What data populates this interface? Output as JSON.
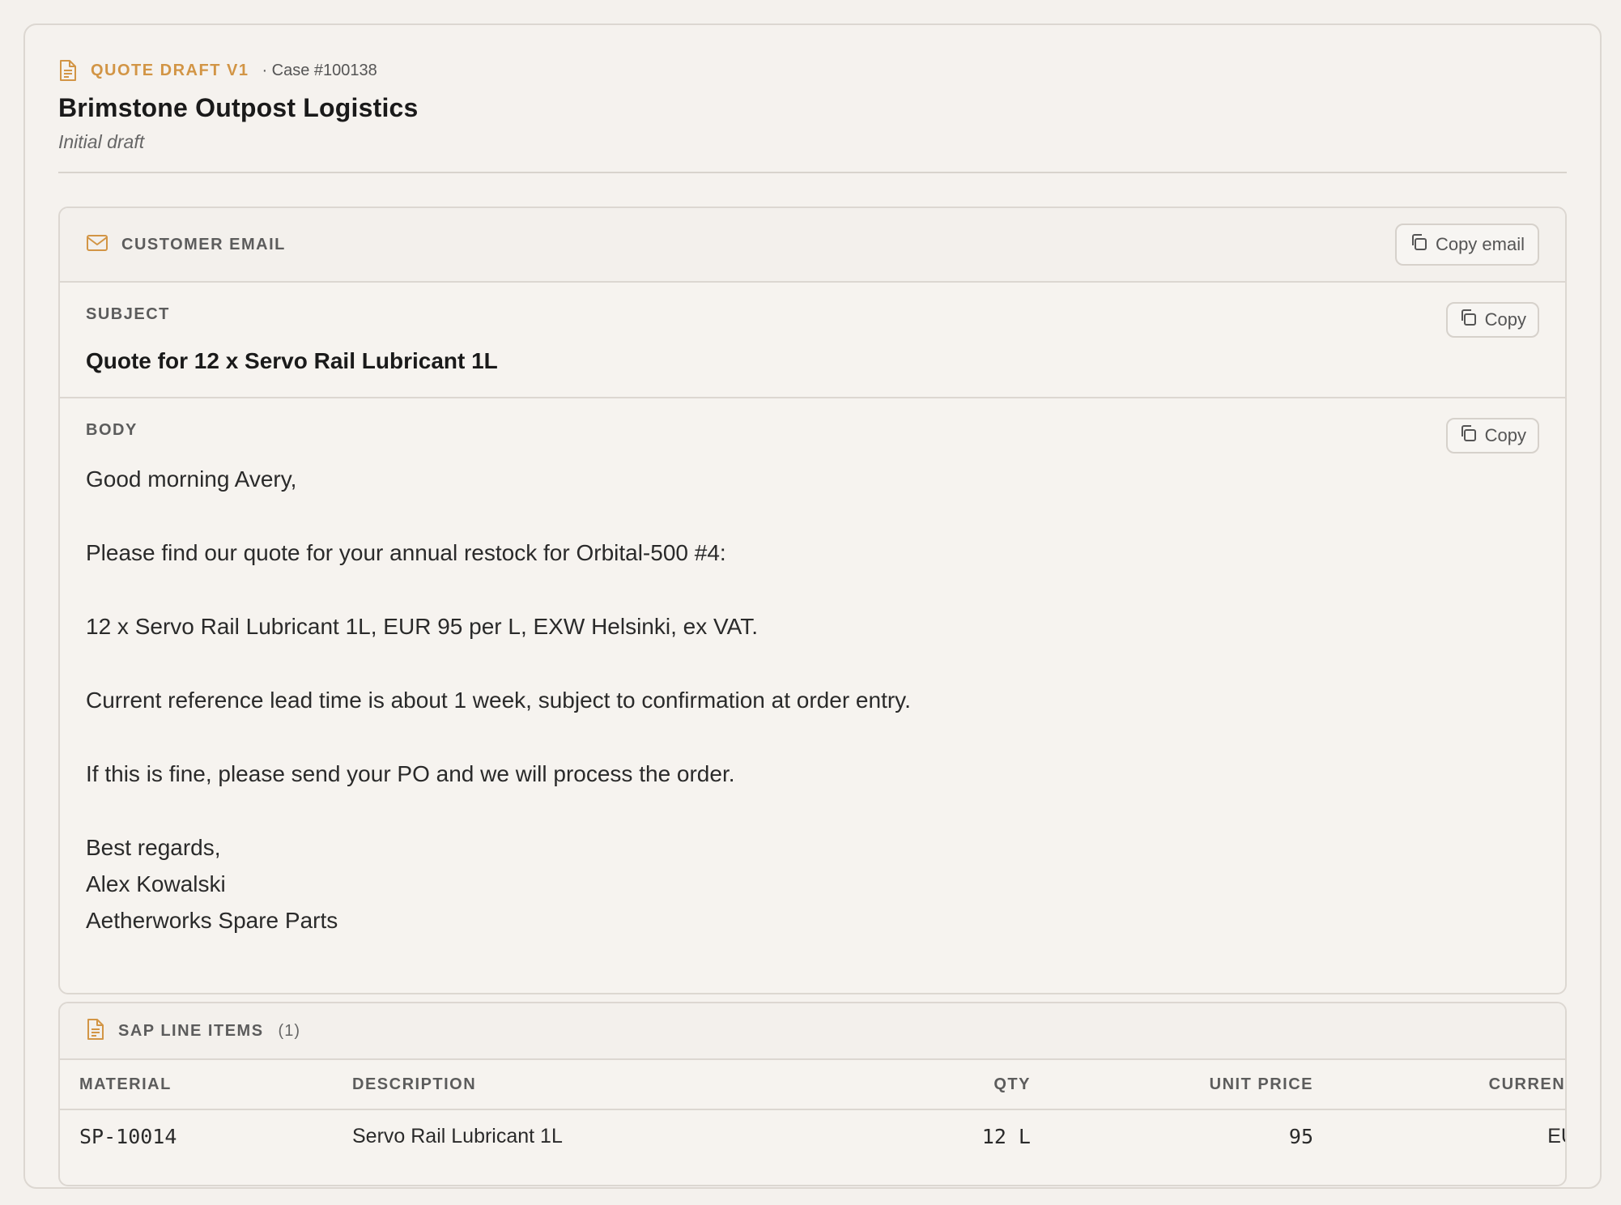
{
  "header": {
    "eyebrow_label": "QUOTE DRAFT V1",
    "case_label": "· Case #100138",
    "title": "Brimstone Outpost Logistics",
    "subtitle": "Initial draft"
  },
  "email": {
    "section_label": "CUSTOMER EMAIL",
    "copy_email_label": "Copy email",
    "subject": {
      "label": "SUBJECT",
      "copy_label": "Copy",
      "value": "Quote for 12 x Servo Rail Lubricant 1L"
    },
    "body": {
      "label": "BODY",
      "copy_label": "Copy",
      "greeting": "Good morning Avery,",
      "paragraph1": "Please find our quote for your annual restock for Orbital-500 #4:",
      "paragraph2": "12 x Servo Rail Lubricant 1L, EUR 95 per L, EXW Helsinki, ex VAT.",
      "paragraph3": "Current reference lead time is about 1 week, subject to confirmation at order entry.",
      "paragraph4": "If this is fine, please send your PO and we will process the order.",
      "signoff": "Best regards,",
      "sender_name": "Alex Kowalski",
      "sender_company": "Aetherworks Spare Parts"
    }
  },
  "line_items": {
    "section_label": "SAP LINE ITEMS",
    "count_label": "(1)",
    "columns": [
      "MATERIAL",
      "DESCRIPTION",
      "QTY",
      "UNIT PRICE",
      "CURRENCY"
    ],
    "rows": [
      {
        "material": "SP-10014",
        "description": "Servo Rail Lubricant 1L",
        "qty": "12 L",
        "unit_price": "95",
        "currency": "EUR"
      }
    ]
  },
  "colors": {
    "accent": "#d29545",
    "border": "#dcd7d1",
    "background": "#f4f1ed"
  }
}
